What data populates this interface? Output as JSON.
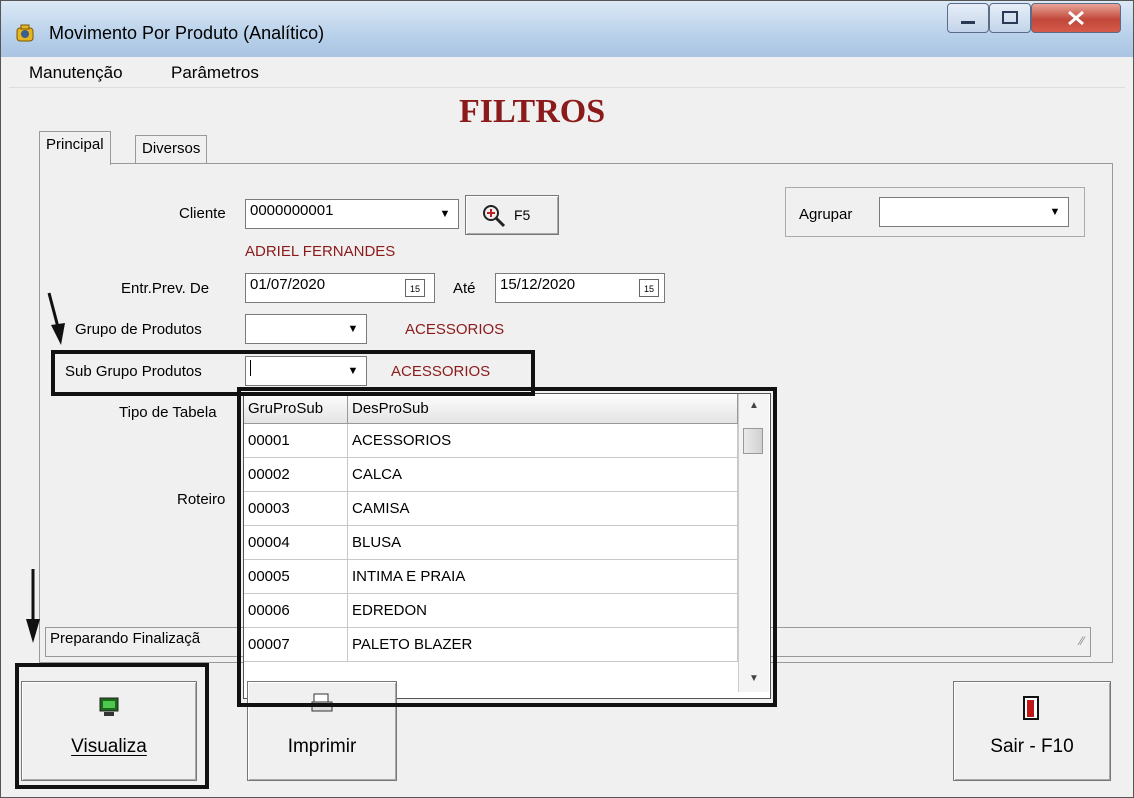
{
  "window": {
    "title": "Movimento Por Produto (Analítico)",
    "controls": [
      "minimize-icon",
      "maximize-icon",
      "close-icon"
    ]
  },
  "menu": {
    "items": [
      "Manutenção",
      "Parâmetros"
    ]
  },
  "heading": "FILTROS",
  "tabs": [
    "Principal",
    "Diversos"
  ],
  "form": {
    "cliente_label": "Cliente",
    "cliente_value": "0000000001",
    "search_button": "F5",
    "cliente_name": "ADRIEL FERNANDES",
    "agrupar_label": "Agrupar",
    "agrupar_value": "",
    "entr_label": "Entr.Prev. De",
    "entr_de": "01/07/2020",
    "ate_label": "Até",
    "ate_value": "15/12/2020",
    "calendar_glyph": "15",
    "grupo_label": "Grupo de Produtos",
    "grupo_value": "",
    "grupo_desc": "ACESSORIOS",
    "sub_label": "Sub Grupo Produtos",
    "sub_value": "",
    "sub_desc": "ACESSORIOS",
    "tipo_label": "Tipo de Tabela",
    "roteiro_label": "Roteiro",
    "status_text": "Preparando Finalizaçã"
  },
  "dropdown": {
    "columns": [
      "GruProSub",
      "DesProSub"
    ],
    "rows": [
      [
        "00001",
        "ACESSORIOS"
      ],
      [
        "00002",
        "CALCA"
      ],
      [
        "00003",
        "CAMISA"
      ],
      [
        "00004",
        "BLUSA"
      ],
      [
        "00005",
        "INTIMA E PRAIA"
      ],
      [
        "00006",
        "EDREDON"
      ],
      [
        "00007",
        "PALETO BLAZER"
      ]
    ]
  },
  "buttons": {
    "visualiza": "Visualiza",
    "imprimir": "Imprimir",
    "sair": "Sair - F10"
  },
  "colors": {
    "accent_red": "#8b1a1a",
    "title_bar": "#b9d1ea"
  }
}
